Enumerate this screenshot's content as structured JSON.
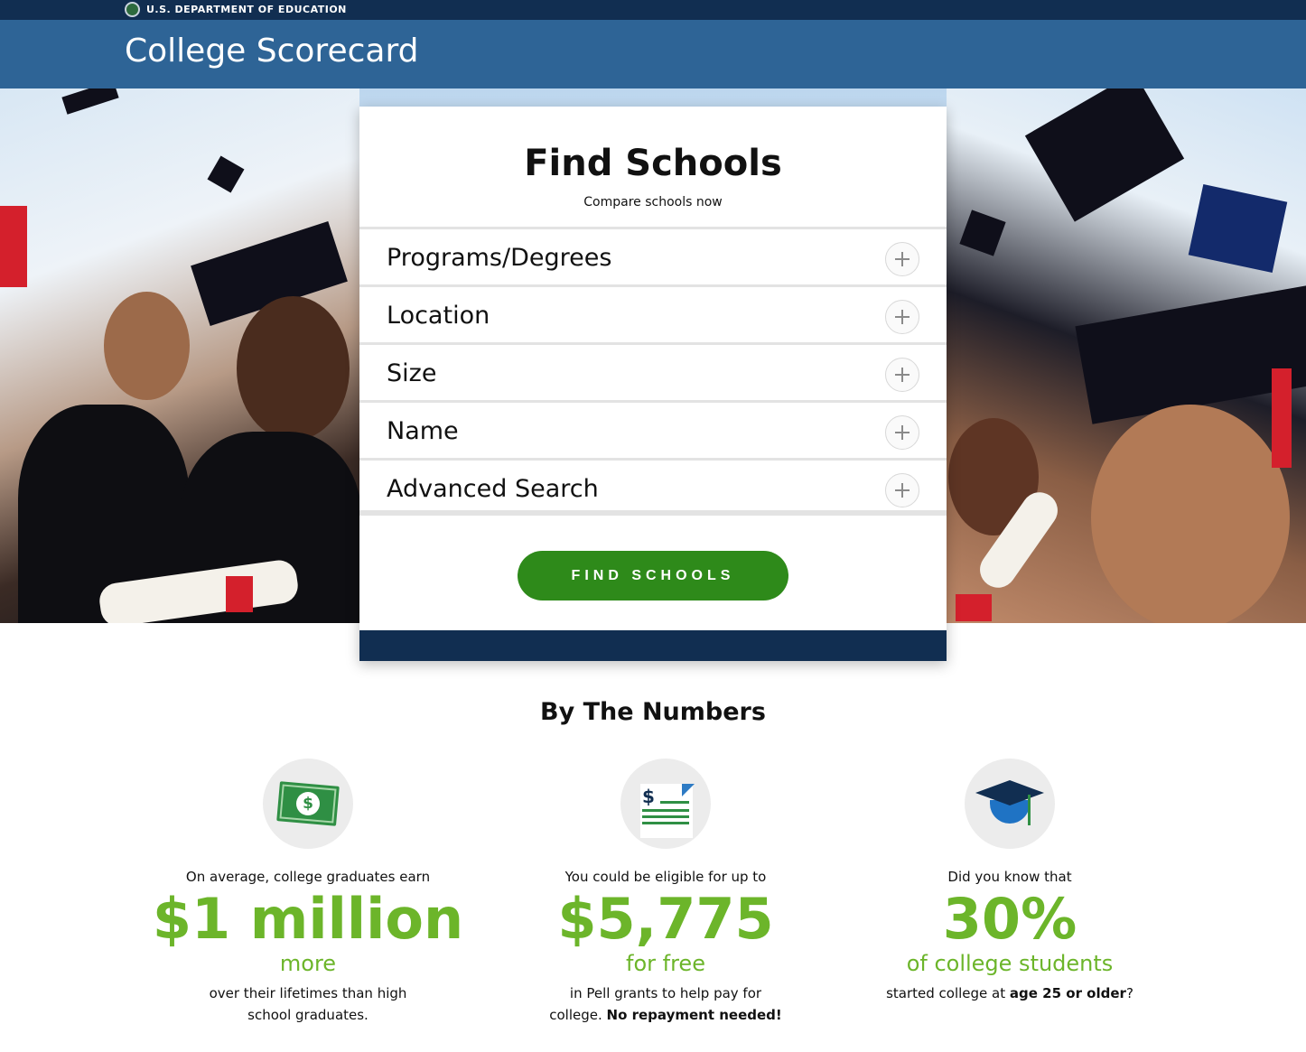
{
  "gov_banner": {
    "label": "U.S. DEPARTMENT OF EDUCATION"
  },
  "header": {
    "title": "College Scorecard"
  },
  "search_card": {
    "title": "Find Schools",
    "subtitle": "Compare schools now",
    "filters": [
      {
        "label": "Programs/Degrees"
      },
      {
        "label": "Location"
      },
      {
        "label": "Size"
      },
      {
        "label": "Name"
      },
      {
        "label": "Advanced Search"
      }
    ],
    "submit_label": "FIND SCHOOLS"
  },
  "by_the_numbers": {
    "title": "By The Numbers",
    "stats": [
      {
        "icon": "money-icon",
        "intro": "On average, college graduates earn",
        "value": "$1 million",
        "sub": "more",
        "desc_1": "over their lifetimes than high",
        "desc_2": "school graduates."
      },
      {
        "icon": "document-icon",
        "intro": "You could be eligible for up to",
        "value": "$5,775",
        "sub": "for free",
        "desc_1": "in Pell grants to help pay for",
        "desc_2": "college.",
        "desc_bold": "No repayment needed!"
      },
      {
        "icon": "graduation-cap-icon",
        "intro": "Did you know that",
        "value": "30%",
        "sub": "of college students",
        "desc_1": "started college at",
        "desc_bold": "age 25 or older",
        "desc_end": "?"
      }
    ]
  },
  "colors": {
    "gov_bar": "#112e51",
    "header": "#2e6496",
    "button": "#2e8a1a",
    "stat_green": "#6cb52a"
  }
}
